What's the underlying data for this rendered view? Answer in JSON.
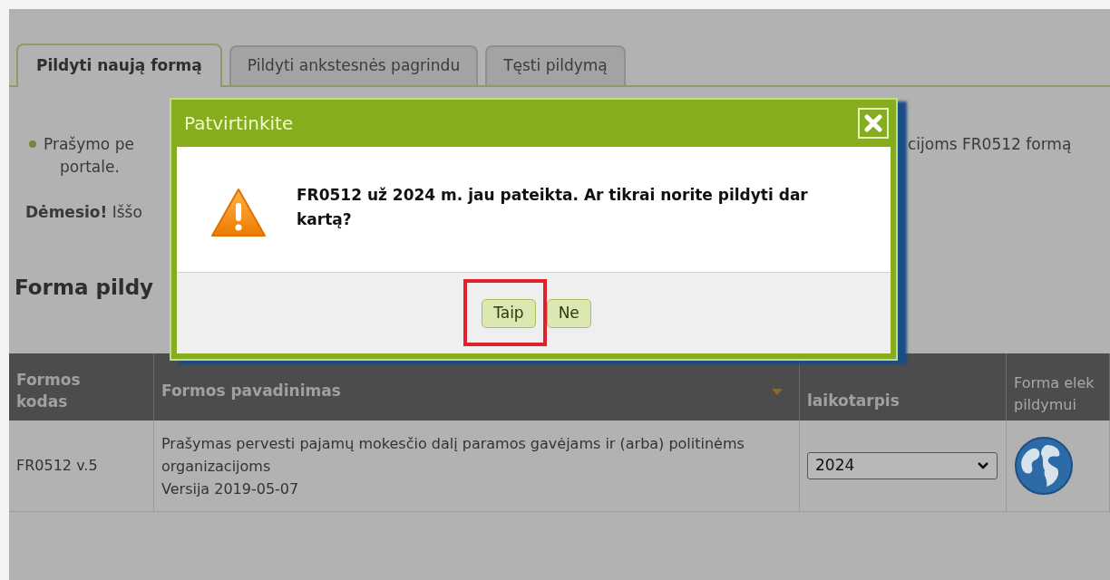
{
  "tabs": [
    {
      "label": "Pildyti naują formą",
      "selected": true
    },
    {
      "label": "Pildyti ankstesnės pagrindu",
      "selected": false
    },
    {
      "label": "Tęsti pildymą",
      "selected": false
    }
  ],
  "notice": {
    "bullet_left": "Prašymo pe",
    "bullet_right": "cijoms FR0512 formą",
    "continuation": "portale.",
    "warning": "**Dėmesio!** Iššo"
  },
  "section_title": "Forma pildy",
  "table": {
    "columns": [
      {
        "label": "Formos kodas",
        "sorted": false
      },
      {
        "label": "Formos pavadinimas",
        "sorted": true
      },
      {
        "label": "laikotarpis",
        "sorted": false
      },
      {
        "label": "Forma elek pildymui",
        "sorted": false
      }
    ],
    "rows": [
      {
        "code": "FR0512 v.5",
        "name": "Prašymas pervesti pajamų mokesčio dalį paramos gavėjams ir (arba) politinėms organizacijoms",
        "version": "Versija 2019-05-07",
        "period": "2024"
      }
    ]
  },
  "dialog": {
    "title": "Patvirtinkite",
    "message": "FR0512 už 2024 m. jau pateikta. Ar tikrai norite pildyti dar kartą?",
    "buttons": [
      {
        "label": "Taip",
        "highlighted": true
      },
      {
        "label": "Ne",
        "highlighted": false
      }
    ]
  }
}
